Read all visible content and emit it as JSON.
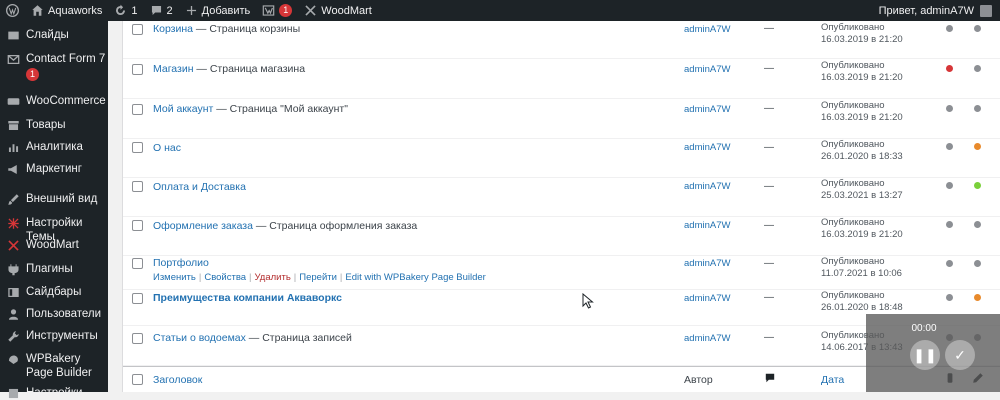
{
  "adminbar": {
    "site_name": "Aquaworks",
    "updates_count": "1",
    "comments_count": "2",
    "add_new": "Добавить",
    "plugin_badge": "1",
    "woodmart": "WoodMart",
    "greeting": "Привет, adminA7W"
  },
  "sidebar": {
    "items": [
      {
        "label": "Слайды",
        "icon": "images-icon"
      },
      {
        "label": "Contact Form 7",
        "icon": "mail-icon",
        "badge": "1"
      },
      {
        "label": "WooCommerce",
        "icon": "woocommerce-icon"
      },
      {
        "label": "Товары",
        "icon": "archive-icon"
      },
      {
        "label": "Аналитика",
        "icon": "chart-bar-icon"
      },
      {
        "label": "Маркетинг",
        "icon": "megaphone-icon"
      },
      {
        "label": "Внешний вид",
        "icon": "paintbrush-icon"
      },
      {
        "label": "Настройки Темы",
        "icon": "theme-settings-icon"
      },
      {
        "label": "WoodMart",
        "icon": "woodmart-icon"
      },
      {
        "label": "Плагины",
        "icon": "plugin-icon"
      },
      {
        "label": "Сайдбары",
        "icon": "sidebar-icon"
      },
      {
        "label": "Пользователи",
        "icon": "users-icon"
      },
      {
        "label": "Инструменты",
        "icon": "wrench-icon"
      },
      {
        "label": "WPBakery Page Builder",
        "icon": "wpbakery-icon"
      },
      {
        "label": "Настройки",
        "icon": "settings-icon"
      }
    ]
  },
  "rows": [
    {
      "title": "Корзина",
      "suffix": " — Страница корзины",
      "author": "adminA7W",
      "comments": "—",
      "status": "Опубликовано",
      "date": "16.03.2019 в 21:20",
      "dot1": "#8c8f94",
      "dot2": "#8c8f94"
    },
    {
      "title": "Магазин",
      "suffix": " — Страница магазина",
      "author": "adminA7W",
      "comments": "—",
      "status": "Опубликовано",
      "date": "16.03.2019 в 21:20",
      "dot1": "#d63638",
      "dot2": "#8c8f94"
    },
    {
      "title": "Мой аккаунт",
      "suffix": " — Страница \"Мой аккаунт\"",
      "author": "adminA7W",
      "comments": "—",
      "status": "Опубликовано",
      "date": "16.03.2019 в 21:20",
      "dot1": "#8c8f94",
      "dot2": "#8c8f94"
    },
    {
      "title": "О нас",
      "suffix": "",
      "author": "adminA7W",
      "comments": "—",
      "status": "Опубликовано",
      "date": "26.01.2020 в 18:33",
      "dot1": "#8c8f94",
      "dot2": "#e88a2c"
    },
    {
      "title": "Оплата и Доставка",
      "suffix": "",
      "author": "adminA7W",
      "comments": "—",
      "status": "Опубликовано",
      "date": "25.03.2021 в 13:27",
      "dot1": "#8c8f94",
      "dot2": "#7ad03a"
    },
    {
      "title": "Оформление заказа",
      "suffix": " — Страница оформления заказа",
      "author": "adminA7W",
      "comments": "—",
      "status": "Опубликовано",
      "date": "16.03.2019 в 21:20",
      "dot1": "#8c8f94",
      "dot2": "#8c8f94"
    },
    {
      "title": "Портфолио",
      "suffix": "",
      "author": "adminA7W",
      "comments": "—",
      "status": "Опубликовано",
      "date": "11.07.2021 в 10:06",
      "dot1": "#8c8f94",
      "dot2": "#8c8f94"
    },
    {
      "title": "Преимущества компании Акваворкс",
      "suffix": "",
      "author": "adminA7W",
      "comments": "—",
      "status": "Опубликовано",
      "date": "26.01.2020 в 18:48",
      "dot1": "#8c8f94",
      "dot2": "#e88a2c"
    },
    {
      "title": "Статьи о водоемах",
      "suffix": " — Страница записей",
      "author": "adminA7W",
      "comments": "—",
      "status": "Опубликовано",
      "date": "14.06.2017 в 13:43",
      "dot1": "#8c8f94",
      "dot2": "#8c8f94"
    }
  ],
  "row_actions": {
    "edit": "Изменить",
    "quick_edit": "Свойства",
    "delete": "Удалить",
    "view": "Перейти",
    "wpbakery": "Edit with WPBakery Page Builder"
  },
  "footer": {
    "title": "Заголовок",
    "author": "Автор",
    "date": "Дата"
  },
  "recorder": {
    "time": "00:00"
  }
}
